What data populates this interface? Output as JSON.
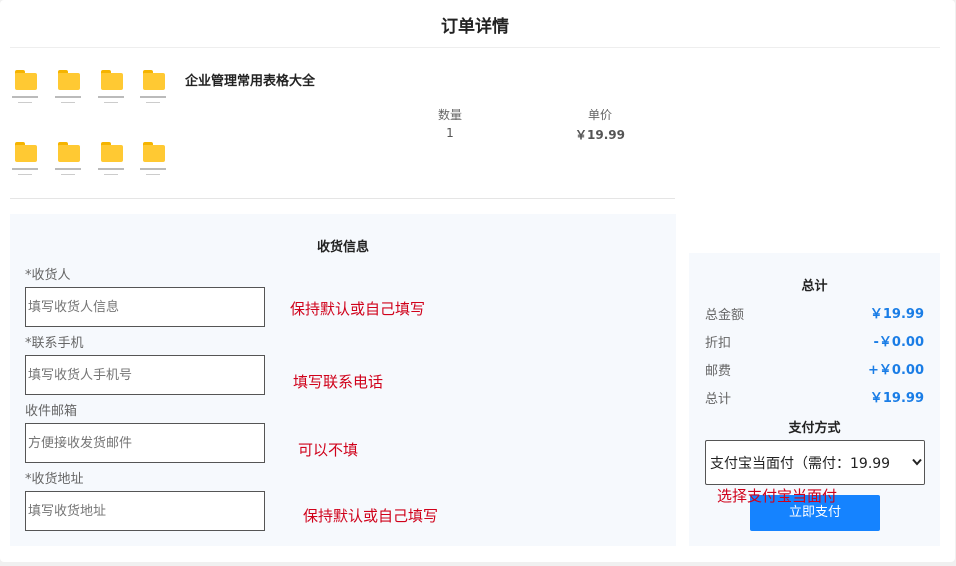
{
  "page_title": "订单详情",
  "product": {
    "name": "企业管理常用表格大全",
    "quantity_label": "数量",
    "quantity": "1",
    "price_label": "单价",
    "price": "￥19.99"
  },
  "shipping": {
    "title": "收货信息",
    "fields": [
      {
        "label": "*收货人",
        "placeholder": "填写收货人信息",
        "note": "保持默认或自己填写"
      },
      {
        "label": "*联系手机",
        "placeholder": "填写收货人手机号",
        "note": "填写联系电话"
      },
      {
        "label": "收件邮箱",
        "placeholder": "方便接收发货邮件",
        "note": "可以不填"
      },
      {
        "label": "*收货地址",
        "placeholder": "填写收货地址",
        "note": "保持默认或自己填写"
      }
    ]
  },
  "summary": {
    "title": "总计",
    "rows": [
      {
        "label": "总金额",
        "value": "￥19.99"
      },
      {
        "label": "折扣",
        "value": "-￥0.00"
      },
      {
        "label": "邮费",
        "value": "+￥0.00"
      },
      {
        "label": "总计",
        "value": "￥19.99"
      }
    ],
    "payment_title": "支付方式",
    "payment_selected": "支付宝当面付（需付：19.99",
    "payment_note": "选择支付宝当面付",
    "pay_button": "立即支付"
  },
  "colors": {
    "accent": "#1583ff",
    "price": "#1a7de6",
    "note": "#d0021b",
    "folder": "#ffc933"
  },
  "icons": [
    "folder-icon",
    "chevron-down-icon"
  ]
}
